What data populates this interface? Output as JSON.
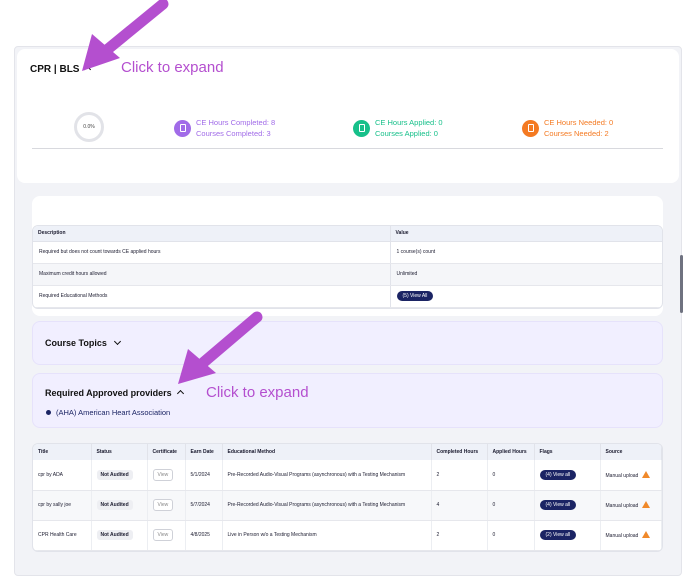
{
  "header": {
    "title": "CPR | BLS"
  },
  "annotations": {
    "top": "Click to expand",
    "providers": "Click to expand"
  },
  "progress": {
    "label": "0.0%",
    "value": 0.0
  },
  "stats": [
    {
      "line1": "CE Hours Completed: 8",
      "line2": "Courses Completed: 3",
      "color": "#a16be8"
    },
    {
      "line1": "CE Hours Applied: 0",
      "line2": "Courses Applied: 0",
      "color": "#17c08a"
    },
    {
      "line1": "CE Hours Needed: 0",
      "line2": "Courses Needed: 2",
      "color": "#f47a22"
    }
  ],
  "requirements": {
    "headers": [
      "Description",
      "Value"
    ],
    "rows": [
      {
        "description": "Required but does not count towards CE applied hours",
        "value": "1 course(s) count"
      },
      {
        "description": "Maximum credit hours allowed",
        "value": "Unlimited"
      },
      {
        "description": "Required Educational Methods",
        "value": "(5) View All"
      }
    ]
  },
  "course_topics": {
    "title": "Course Topics"
  },
  "providers": {
    "title": "Required Approved providers",
    "items": [
      "(AHA) American Heart Association"
    ]
  },
  "courses": {
    "headers": [
      "Title",
      "Status",
      "Certificate",
      "Earn Date",
      "Educational Method",
      "Completed Hours",
      "Applied Hours",
      "Flags",
      "Source"
    ],
    "rows": [
      {
        "title": "cpr by ADA",
        "status": "Not Audited",
        "certificate": "View",
        "earn_date": "5/1/2024",
        "method": "Pre-Recorded Audio-Visual Programs (asynchronous) with a Testing Mechanism",
        "completed": "2",
        "applied": "0",
        "flags": "(4) View all",
        "source": "Manual upload"
      },
      {
        "title": "cpr by sally joe",
        "status": "Not Audited",
        "certificate": "View",
        "earn_date": "5/7/2024",
        "method": "Pre-Recorded Audio-Visual Programs (asynchronous) with a Testing Mechanism",
        "completed": "4",
        "applied": "0",
        "flags": "(4) View all",
        "source": "Manual upload"
      },
      {
        "title": "CPR Health Care",
        "status": "Not Audited",
        "certificate": "View",
        "earn_date": "4/8/2025",
        "method": "Live in Person w/o a Testing Mechanism",
        "completed": "2",
        "applied": "0",
        "flags": "(2) View all",
        "source": "Manual upload"
      }
    ]
  },
  "colors": {
    "navy": "#1b2464",
    "annotation": "#b44fcf",
    "warning": "#f0892a"
  }
}
